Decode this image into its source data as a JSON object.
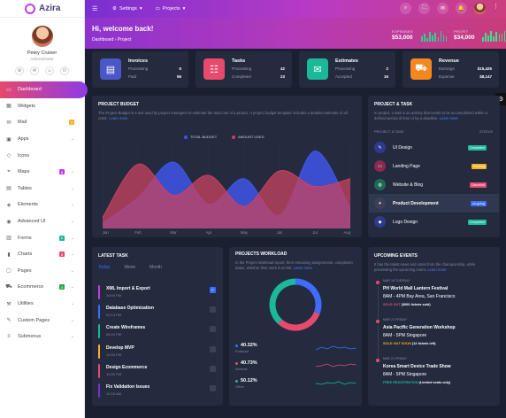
{
  "brand": {
    "name": "Azira"
  },
  "profile": {
    "name": "Petey Cruiser",
    "role": "Administrator",
    "icons": [
      "settings-icon",
      "mail-icon",
      "user-icon",
      "power-icon"
    ]
  },
  "sidebar": {
    "items": [
      {
        "label": "Dashboard",
        "icon": "monitor-icon",
        "active": true
      },
      {
        "label": "Widgets",
        "icon": "widgets-icon"
      },
      {
        "label": "Mail",
        "icon": "mail-icon",
        "badge": "3",
        "badge_color": "#f5b225"
      },
      {
        "label": "Apps",
        "icon": "apps-icon",
        "chevron": true
      },
      {
        "label": "Icons",
        "icon": "icons-icon"
      },
      {
        "label": "Maps",
        "icon": "map-icon",
        "badge": "8",
        "badge_color": "#c13de2",
        "chevron": true
      },
      {
        "label": "Tables",
        "icon": "table-icon",
        "chevron": true
      },
      {
        "label": "Elements",
        "icon": "elements-icon",
        "chevron": true
      },
      {
        "label": "Advanced UI",
        "icon": "advanced-icon",
        "chevron": true
      },
      {
        "label": "Forms",
        "icon": "forms-icon",
        "badge": "6",
        "badge_color": "#1bb99a",
        "chevron": true
      },
      {
        "label": "Charts",
        "icon": "chart-icon",
        "badge": "5",
        "badge_color": "#e84a6e",
        "chevron": true
      },
      {
        "label": "Pages",
        "icon": "pages-icon",
        "chevron": true
      },
      {
        "label": "Ecommerce",
        "icon": "cart-icon",
        "badge": "3",
        "badge_color": "#28a745",
        "chevron": true
      },
      {
        "label": "Utilities",
        "icon": "utilities-icon",
        "chevron": true
      },
      {
        "label": "Custom Pages",
        "icon": "custom-icon",
        "chevron": true
      },
      {
        "label": "Submenus",
        "icon": "submenu-icon",
        "chevron": true
      }
    ]
  },
  "topbar": {
    "settings_label": "Settings",
    "projects_label": "Projects"
  },
  "welcome": {
    "title": "Hi, welcome back!",
    "breadcrumb": "Dashboard › Project",
    "expenses_label": "EXPENSES",
    "expenses_value": "$53,000",
    "profit_label": "PROFIT",
    "profit_value": "$34,000"
  },
  "stats": [
    {
      "title": "Invoices",
      "icon": "invoice-icon",
      "color": "#4b57c8",
      "row1_label": "Processing",
      "row1_value": "5",
      "row2_label": "Paid",
      "row2_value": "56"
    },
    {
      "title": "Tasks",
      "icon": "tasks-icon",
      "color": "#e84a6e",
      "row1_label": "Processing",
      "row1_value": "42",
      "row2_label": "Completed",
      "row2_value": "23"
    },
    {
      "title": "Estimates",
      "icon": "estimates-icon",
      "color": "#1bb99a",
      "row1_label": "Processing",
      "row1_value": "2",
      "row2_label": "Accepted",
      "row2_value": "16"
    },
    {
      "title": "Revenue",
      "icon": "revenue-icon",
      "color": "#f5871f",
      "row1_label": "Earnings",
      "row1_value": "$15,425",
      "row2_label": "Expense",
      "row2_value": "$8,147"
    }
  ],
  "budget": {
    "title": "PROJECT BUDGET",
    "desc": "The Project Budget is a tool used by project managers to estimate the total cost of a project. A project budget template includes a detailed estimate of all costs.",
    "link": "Learn more"
  },
  "chart_data": {
    "type": "area",
    "categories": [
      "Jan",
      "Feb",
      "Mar",
      "Apr",
      "May",
      "Jun",
      "Jul",
      "Aug"
    ],
    "series": [
      {
        "name": "TOTAL BUDGET",
        "color": "#3f55e6",
        "values": [
          5,
          28,
          60,
          22,
          45,
          12,
          70,
          18
        ]
      },
      {
        "name": "AMOUNT USED",
        "color": "#c8435f",
        "values": [
          10,
          58,
          30,
          48,
          20,
          52,
          38,
          45
        ]
      }
    ],
    "ylim": [
      0,
      80
    ]
  },
  "project_task": {
    "title": "PROJECT & TASK",
    "desc": "In project, a task is an activity that needs to be accomplished within a defined period of time or by a deadline.",
    "link": "Learn more",
    "col1": "PROJECT & TASK",
    "col2": "STATUS",
    "rows": [
      {
        "name": "UI Design",
        "avatar_color": "#2f3a8f",
        "icon": "design-icon",
        "status": "Completed",
        "status_color": "#1bb99a"
      },
      {
        "name": "Landing Page",
        "avatar_color": "#8a2a4a",
        "icon": "landing-icon",
        "status": "Pending",
        "status_color": "#f5b225"
      },
      {
        "name": "Website & Blog",
        "avatar_color": "#1e6a55",
        "icon": "website-icon",
        "status": "Canceled",
        "status_color": "#e84a6e"
      },
      {
        "name": "Product Development",
        "avatar_color": "#3b3f58",
        "icon": "product-icon",
        "status": "on-going",
        "status_color": "#3d6cff",
        "selected": true
      },
      {
        "name": "Logo Design",
        "avatar_color": "#2f3a8f",
        "icon": "logo-icon",
        "status": "Completed",
        "status_color": "#1bb99a"
      }
    ]
  },
  "latest_task": {
    "title": "LATEST TASK",
    "tabs": [
      "Today",
      "Week",
      "Month"
    ],
    "tasks": [
      {
        "name": "XML Import & Export",
        "time": "10:00 PM",
        "color": "#c13de2",
        "checked": true
      },
      {
        "name": "Database Optimization",
        "time": "02:13 PM",
        "color": "#3d6cff",
        "checked": false
      },
      {
        "name": "Create Wireframes",
        "time": "06:20 PM",
        "color": "#1bb99a",
        "checked": false
      },
      {
        "name": "Develop MVP",
        "time": "10:00 PM",
        "color": "#f5b225",
        "checked": false
      },
      {
        "name": "Design Ecommerce",
        "time": "10:00 PM",
        "color": "#e84a6e",
        "checked": false
      },
      {
        "name": "Fix Validation Issues",
        "time": "12:00 AM",
        "color": "#7b2fd1",
        "checked": false
      }
    ]
  },
  "workload": {
    "title": "PROJECTS WORKLOAD",
    "desc": "In the Project Workload report, their remaining assignments, completion dates, whether their work is at risk.",
    "link": "Learn more",
    "donut": [
      {
        "label": "External",
        "pct": 40.32,
        "color": "#3d6cff"
      },
      {
        "label": "Internal",
        "pct": 40.73,
        "color": "#e84a6e"
      },
      {
        "label": "Other",
        "pct": 50.12,
        "color": "#1bb99a"
      }
    ],
    "items": [
      {
        "value": "40.32%",
        "label": "External",
        "color": "#3d6cff"
      },
      {
        "value": "40.73%",
        "label": "Internal",
        "color": "#e84a6e"
      },
      {
        "value": "50.12%",
        "label": "Other",
        "color": "#1bb99a"
      }
    ]
  },
  "events": {
    "title": "UPCOMING EVENTS",
    "desc": "It has the latest news and notes from the championship, while previewing the upcoming event.",
    "link": "Learn more",
    "list": [
      {
        "date": "MAR 19 TUESDAY",
        "title": "PH World Mall Lantern Festival",
        "time": "8AM - 4PM Bay Area, San Francisco",
        "note_tag": "SOLD OUT",
        "note": "(3000 tickets sold)",
        "note_color": "#e84a6e"
      },
      {
        "date": "MAR 21 FRIDAY",
        "title": "Asia Pacific Generation Workshop",
        "time": "8AM - 5PM Singapore",
        "note_tag": "SOLD OUT SOON",
        "note": "(12 tickets left)",
        "note_color": "#f5b225"
      },
      {
        "date": "MAR 21 FRIDAY",
        "title": "Korea Smart Device Trade Show",
        "time": "8AM - 5PM Singapore",
        "note_tag": "FREE REGISTRATION",
        "note": "(Limited seats only)",
        "note_color": "#1bb99a"
      }
    ]
  }
}
